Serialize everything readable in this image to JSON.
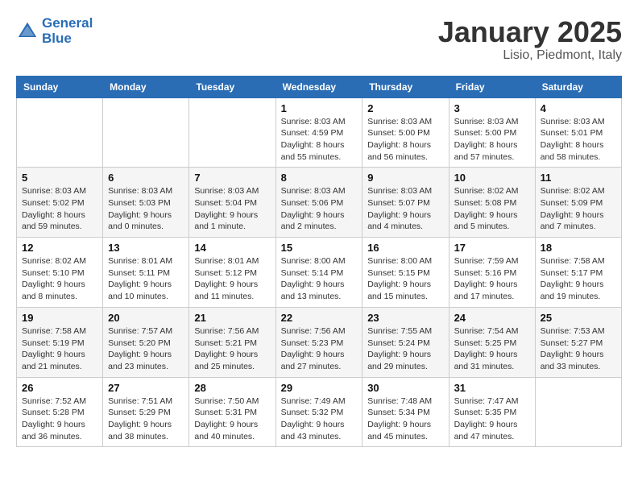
{
  "header": {
    "logo_line1": "General",
    "logo_line2": "Blue",
    "month": "January 2025",
    "location": "Lisio, Piedmont, Italy"
  },
  "weekdays": [
    "Sunday",
    "Monday",
    "Tuesday",
    "Wednesday",
    "Thursday",
    "Friday",
    "Saturday"
  ],
  "weeks": [
    [
      {
        "day": "",
        "info": ""
      },
      {
        "day": "",
        "info": ""
      },
      {
        "day": "",
        "info": ""
      },
      {
        "day": "1",
        "info": "Sunrise: 8:03 AM\nSunset: 4:59 PM\nDaylight: 8 hours\nand 55 minutes."
      },
      {
        "day": "2",
        "info": "Sunrise: 8:03 AM\nSunset: 5:00 PM\nDaylight: 8 hours\nand 56 minutes."
      },
      {
        "day": "3",
        "info": "Sunrise: 8:03 AM\nSunset: 5:00 PM\nDaylight: 8 hours\nand 57 minutes."
      },
      {
        "day": "4",
        "info": "Sunrise: 8:03 AM\nSunset: 5:01 PM\nDaylight: 8 hours\nand 58 minutes."
      }
    ],
    [
      {
        "day": "5",
        "info": "Sunrise: 8:03 AM\nSunset: 5:02 PM\nDaylight: 8 hours\nand 59 minutes."
      },
      {
        "day": "6",
        "info": "Sunrise: 8:03 AM\nSunset: 5:03 PM\nDaylight: 9 hours\nand 0 minutes."
      },
      {
        "day": "7",
        "info": "Sunrise: 8:03 AM\nSunset: 5:04 PM\nDaylight: 9 hours\nand 1 minute."
      },
      {
        "day": "8",
        "info": "Sunrise: 8:03 AM\nSunset: 5:06 PM\nDaylight: 9 hours\nand 2 minutes."
      },
      {
        "day": "9",
        "info": "Sunrise: 8:03 AM\nSunset: 5:07 PM\nDaylight: 9 hours\nand 4 minutes."
      },
      {
        "day": "10",
        "info": "Sunrise: 8:02 AM\nSunset: 5:08 PM\nDaylight: 9 hours\nand 5 minutes."
      },
      {
        "day": "11",
        "info": "Sunrise: 8:02 AM\nSunset: 5:09 PM\nDaylight: 9 hours\nand 7 minutes."
      }
    ],
    [
      {
        "day": "12",
        "info": "Sunrise: 8:02 AM\nSunset: 5:10 PM\nDaylight: 9 hours\nand 8 minutes."
      },
      {
        "day": "13",
        "info": "Sunrise: 8:01 AM\nSunset: 5:11 PM\nDaylight: 9 hours\nand 10 minutes."
      },
      {
        "day": "14",
        "info": "Sunrise: 8:01 AM\nSunset: 5:12 PM\nDaylight: 9 hours\nand 11 minutes."
      },
      {
        "day": "15",
        "info": "Sunrise: 8:00 AM\nSunset: 5:14 PM\nDaylight: 9 hours\nand 13 minutes."
      },
      {
        "day": "16",
        "info": "Sunrise: 8:00 AM\nSunset: 5:15 PM\nDaylight: 9 hours\nand 15 minutes."
      },
      {
        "day": "17",
        "info": "Sunrise: 7:59 AM\nSunset: 5:16 PM\nDaylight: 9 hours\nand 17 minutes."
      },
      {
        "day": "18",
        "info": "Sunrise: 7:58 AM\nSunset: 5:17 PM\nDaylight: 9 hours\nand 19 minutes."
      }
    ],
    [
      {
        "day": "19",
        "info": "Sunrise: 7:58 AM\nSunset: 5:19 PM\nDaylight: 9 hours\nand 21 minutes."
      },
      {
        "day": "20",
        "info": "Sunrise: 7:57 AM\nSunset: 5:20 PM\nDaylight: 9 hours\nand 23 minutes."
      },
      {
        "day": "21",
        "info": "Sunrise: 7:56 AM\nSunset: 5:21 PM\nDaylight: 9 hours\nand 25 minutes."
      },
      {
        "day": "22",
        "info": "Sunrise: 7:56 AM\nSunset: 5:23 PM\nDaylight: 9 hours\nand 27 minutes."
      },
      {
        "day": "23",
        "info": "Sunrise: 7:55 AM\nSunset: 5:24 PM\nDaylight: 9 hours\nand 29 minutes."
      },
      {
        "day": "24",
        "info": "Sunrise: 7:54 AM\nSunset: 5:25 PM\nDaylight: 9 hours\nand 31 minutes."
      },
      {
        "day": "25",
        "info": "Sunrise: 7:53 AM\nSunset: 5:27 PM\nDaylight: 9 hours\nand 33 minutes."
      }
    ],
    [
      {
        "day": "26",
        "info": "Sunrise: 7:52 AM\nSunset: 5:28 PM\nDaylight: 9 hours\nand 36 minutes."
      },
      {
        "day": "27",
        "info": "Sunrise: 7:51 AM\nSunset: 5:29 PM\nDaylight: 9 hours\nand 38 minutes."
      },
      {
        "day": "28",
        "info": "Sunrise: 7:50 AM\nSunset: 5:31 PM\nDaylight: 9 hours\nand 40 minutes."
      },
      {
        "day": "29",
        "info": "Sunrise: 7:49 AM\nSunset: 5:32 PM\nDaylight: 9 hours\nand 43 minutes."
      },
      {
        "day": "30",
        "info": "Sunrise: 7:48 AM\nSunset: 5:34 PM\nDaylight: 9 hours\nand 45 minutes."
      },
      {
        "day": "31",
        "info": "Sunrise: 7:47 AM\nSunset: 5:35 PM\nDaylight: 9 hours\nand 47 minutes."
      },
      {
        "day": "",
        "info": ""
      }
    ]
  ]
}
